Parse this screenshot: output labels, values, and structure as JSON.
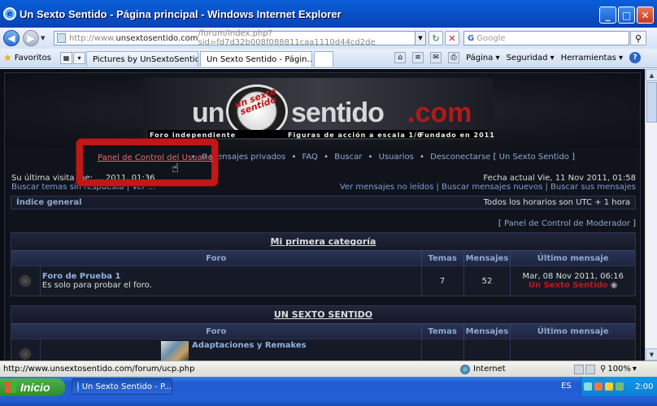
{
  "window": {
    "title": "Un Sexto Sentido - Página principal - Windows Internet Explorer",
    "minimize": "_",
    "maximize": "□",
    "close": "✕"
  },
  "address": {
    "prefix": "http://www.",
    "domain": "unsextosentido.com",
    "rest": "/forum/index.php?sid=fd7d32b008f088811caa1110d44cd2de"
  },
  "search": {
    "placeholder": "Google",
    "g": "G"
  },
  "favorites": {
    "label": "Favoritos"
  },
  "tabs": [
    {
      "label": "Pictures by UnSextoSentido -..."
    },
    {
      "label": "Un Sexto Sentido - Págin...",
      "close": "✕"
    }
  ],
  "commands": {
    "pagina": "Página ▾",
    "seguridad": "Seguridad ▾",
    "herramientas": "Herramientas ▾",
    "help": "?"
  },
  "banner": {
    "uno": "un",
    "logo": "un sexto sentido",
    "sentido": "sentido",
    "com": ".com",
    "sub1": "Foro independiente",
    "sub2": "Figuras de acción a escala 1/6",
    "sub3": "Fundado en 2011"
  },
  "nav": {
    "ucp": "Panel de Control del Usuario",
    "pm": "0 mensajes privados",
    "faq": "FAQ",
    "buscar": "Buscar",
    "usuarios": "Usuarios",
    "desconectarse": "Desconectarse",
    "site": "Un Sexto Sentido",
    "sep": "•"
  },
  "info": {
    "last_visit": "Su última visita fue: ... 2011, 01:36",
    "links_left": "Buscar temas sin respuesta | Ver ...",
    "current_date": "Fecha actual Vie, 11 Nov 2011, 01:58",
    "links_right": "Ver mensajes no leídos | Buscar mensajes nuevos | Buscar sus mensajes"
  },
  "crumb": {
    "index": "Índice general",
    "tz": "Todos los horarios son UTC + 1 hora"
  },
  "modlink": {
    "open": "[ ",
    "label": "Panel de Control de Moderador",
    "close": " ]"
  },
  "headers": {
    "forum": "Foro",
    "temas": "Temas",
    "mensajes": "Mensajes",
    "ultimo": "Último mensaje"
  },
  "categories": [
    {
      "title": "Mi primera categoría",
      "forums": [
        {
          "name": "Foro de Prueba 1",
          "desc": "Es solo para probar el foro.",
          "temas": "7",
          "mensajes": "52",
          "last_date": "Mar, 08 Nov 2011, 06:16",
          "last_user": "Un Sexto Sentido"
        }
      ]
    },
    {
      "title": "UN SEXTO SENTIDO",
      "forums": [
        {
          "name": "Adaptaciones y Remakes"
        }
      ]
    }
  ],
  "status": {
    "url": "http://www.unsextosentido.com/forum/ucp.php",
    "zone": "Internet",
    "zoom": "100%"
  },
  "taskbar": {
    "start": "Inicio",
    "task": "Un Sexto Sentido - P...",
    "lang": "ES",
    "clock": "2:00"
  }
}
